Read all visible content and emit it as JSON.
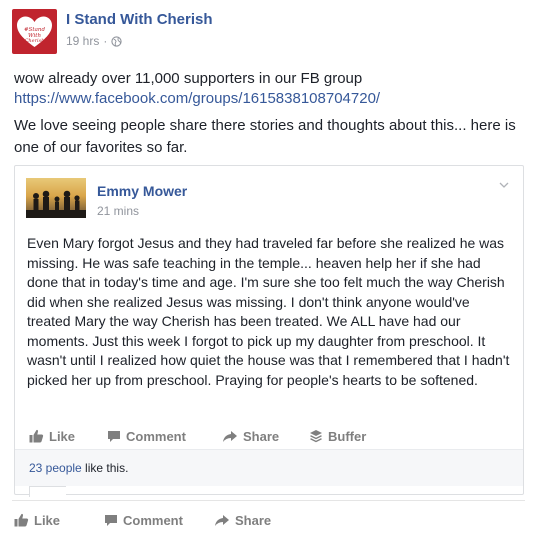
{
  "post": {
    "page_name": "I Stand With Cherish",
    "avatar_text": "#Stand With Cherish",
    "time": "19 hrs",
    "separator": "·",
    "line1": "wow already over 11,000 supporters in our FB group",
    "link": "https://www.facebook.com/groups/1615838108704720/",
    "line2": "We love seeing people share there stories and thoughts about this... here is one of our favorites so far."
  },
  "shared_post": {
    "author": "Emmy Mower",
    "time": "21 mins",
    "body": "Even Mary forgot Jesus and they had traveled far before she realized he was missing. He was safe teaching in the temple... heaven help her if she had done that in today's time and age. I'm sure she too felt much the way Cherish did when she realized Jesus was missing. I don't think anyone would've treated Mary the way Cherish has been treated. We ALL have had our moments. Just this week I forgot to pick up my daughter from preschool. It wasn't until I realized how quiet the house was that I remembered that I hadn't picked her up from preschool. Praying for people's hearts to be softened.",
    "actions": {
      "like": "Like",
      "comment": "Comment",
      "share": "Share",
      "buffer": "Buffer"
    },
    "likes_count": "23 people",
    "likes_suffix": " like this."
  },
  "actions": {
    "like": "Like",
    "comment": "Comment",
    "share": "Share"
  },
  "colors": {
    "link": "#365899",
    "meta": "#90949c",
    "avatar_bg": "#c0242e",
    "action_text": "#7f7f7f"
  },
  "icons": [
    "globe-icon",
    "chevron-down-icon",
    "like-icon",
    "comment-icon",
    "share-icon",
    "buffer-icon"
  ]
}
